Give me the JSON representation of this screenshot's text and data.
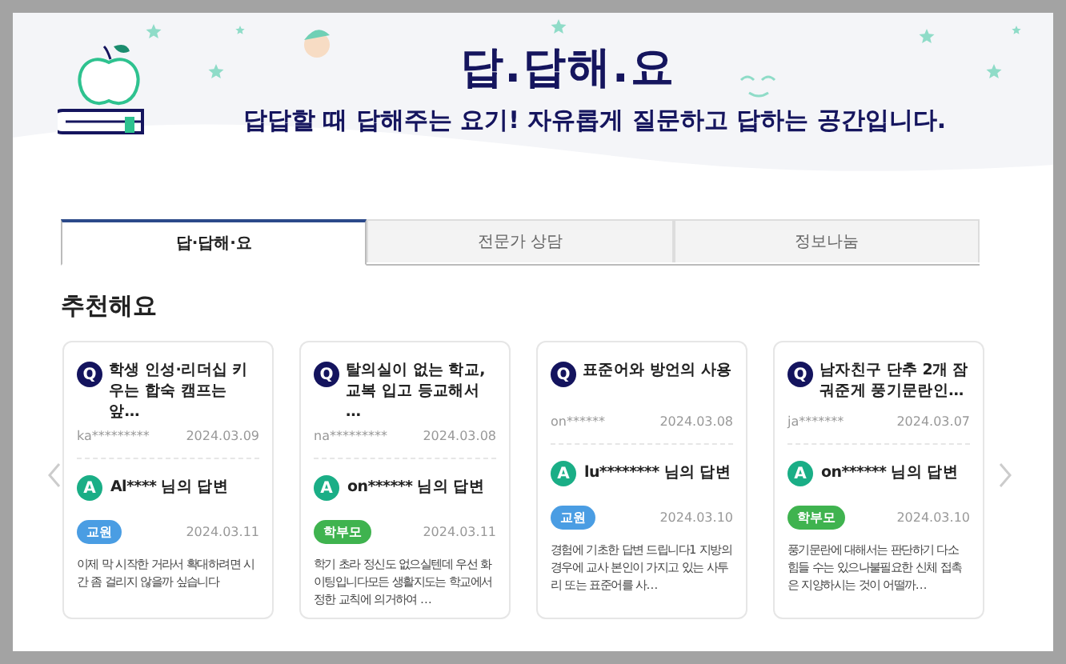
{
  "banner": {
    "title": "답.답해.요",
    "subtitle": "답답할 때 답해주는 요기! 자유롭게 질문하고 답하는 공간입니다."
  },
  "tabs": [
    {
      "label": "답·답해·요",
      "selected": true
    },
    {
      "label": "전문가 상담",
      "selected": false
    },
    {
      "label": "정보나눔",
      "selected": false
    }
  ],
  "section_title": "추천해요",
  "cards": [
    {
      "q_mark": "Q",
      "question": "학생 인성·리더십 키우는 합숙 캠프는 앞…",
      "asker": "ka*********",
      "asked_date": "2024.03.09",
      "a_mark": "A",
      "answerer": "Al**** 님의 답변",
      "badge": "교원",
      "color": "#4a9de3",
      "answer_date": "2024.03.11",
      "answer": "이제 막 시작한 거라서 확대하려면 시간 좀 걸리지 않을까 싶습니다"
    },
    {
      "q_mark": "Q",
      "question": "탈의실이 없는 학교, 교복 입고 등교해서 …",
      "asker": "na*********",
      "asked_date": "2024.03.08",
      "a_mark": "A",
      "answerer": "on****** 님의 답변",
      "badge": "학부모",
      "color": "#3fb34f",
      "answer_date": "2024.03.11",
      "answer": "학기 초라 정신도 없으실텐데 우선 화이팅입니다모든 생활지도는 학교에서 정한 교칙에 의거하여 …"
    },
    {
      "q_mark": "Q",
      "question": "표준어와 방언의 사용",
      "asker": "on******",
      "asked_date": "2024.03.08",
      "a_mark": "A",
      "answerer": "lu******** 님의 답변",
      "badge": "교원",
      "color": "#4a9de3",
      "answer_date": "2024.03.10",
      "answer": "경험에 기초한 답변 드립니다1 지방의 경우에 교사 본인이 가지고 있는 사투리 또는 표준어를 사…"
    },
    {
      "q_mark": "Q",
      "question": "남자친구 단추 2개 잠궈준게 풍기문란인…",
      "asker": "ja*******",
      "asked_date": "2024.03.07",
      "a_mark": "A",
      "answerer": "on****** 님의 답변",
      "badge": "학부모",
      "color": "#3fb34f",
      "answer_date": "2024.03.10",
      "answer": "풍기문란에 대해서는 판단하기 다소 힘들 수는 있으나불필요한 신체 접촉은 지양하시는 것이 어떨까…"
    }
  ]
}
